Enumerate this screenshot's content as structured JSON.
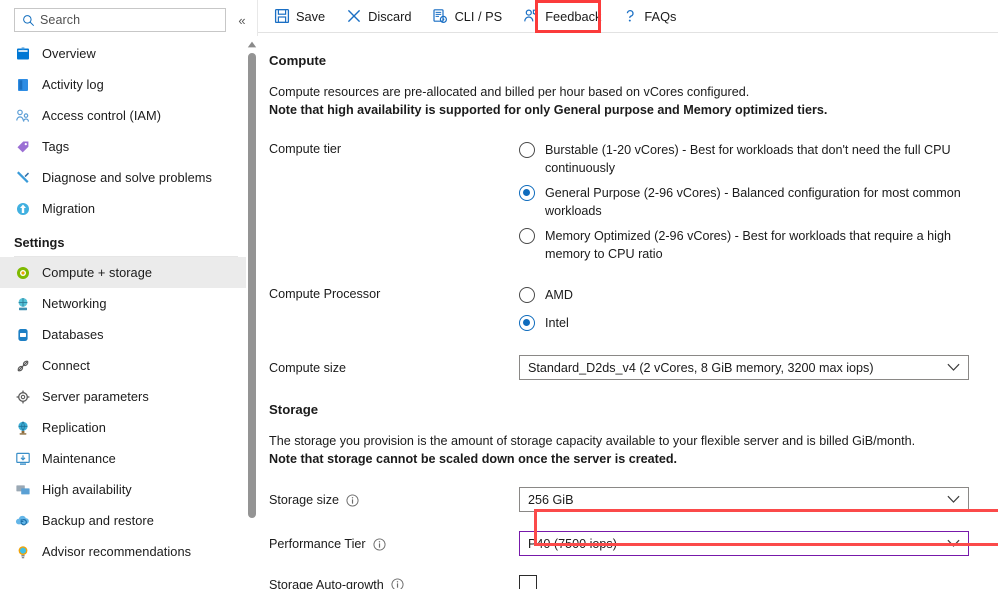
{
  "sidebar": {
    "search": {
      "placeholder": "Search",
      "icon": "search-icon"
    },
    "collapse_label": "«",
    "items": [
      {
        "label": "Overview",
        "icon": "overview-icon",
        "selected": false
      },
      {
        "label": "Activity log",
        "icon": "activity-log-icon",
        "selected": false
      },
      {
        "label": "Access control (IAM)",
        "icon": "access-control-icon",
        "selected": false
      },
      {
        "label": "Tags",
        "icon": "tags-icon",
        "selected": false
      },
      {
        "label": "Diagnose and solve problems",
        "icon": "diagnose-icon",
        "selected": false
      },
      {
        "label": "Migration",
        "icon": "migration-icon",
        "selected": false
      }
    ],
    "group_label": "Settings",
    "settings_items": [
      {
        "label": "Compute + storage",
        "icon": "compute-storage-icon",
        "selected": true
      },
      {
        "label": "Networking",
        "icon": "networking-icon",
        "selected": false
      },
      {
        "label": "Databases",
        "icon": "databases-icon",
        "selected": false
      },
      {
        "label": "Connect",
        "icon": "connect-icon",
        "selected": false
      },
      {
        "label": "Server parameters",
        "icon": "server-parameters-icon",
        "selected": false
      },
      {
        "label": "Replication",
        "icon": "replication-icon",
        "selected": false
      },
      {
        "label": "Maintenance",
        "icon": "maintenance-icon",
        "selected": false
      },
      {
        "label": "High availability",
        "icon": "high-availability-icon",
        "selected": false
      },
      {
        "label": "Backup and restore",
        "icon": "backup-restore-icon",
        "selected": false
      },
      {
        "label": "Advisor recommendations",
        "icon": "advisor-icon",
        "selected": false
      }
    ]
  },
  "toolbar": {
    "save_label": "Save",
    "discard_label": "Discard",
    "cli_ps_label": "CLI / PS",
    "feedback_label": "Feedback",
    "faqs_label": "FAQs"
  },
  "compute": {
    "title": "Compute",
    "desc_line1": "Compute resources are pre-allocated and billed per hour based on vCores configured.",
    "desc_line2": "Note that high availability is supported for only General purpose and Memory optimized tiers.",
    "tier_label": "Compute tier",
    "tier_options": [
      {
        "text": "Burstable (1-20 vCores) - Best for workloads that don't need the full CPU continuously",
        "checked": false
      },
      {
        "text": "General Purpose (2-96 vCores) - Balanced configuration for most common workloads",
        "checked": true
      },
      {
        "text": "Memory Optimized (2-96 vCores) - Best for workloads that require a high memory to CPU ratio",
        "checked": false
      }
    ],
    "processor_label": "Compute Processor",
    "processor_options": [
      {
        "text": "AMD",
        "checked": false
      },
      {
        "text": "Intel",
        "checked": true
      }
    ],
    "size_label": "Compute size",
    "size_value": "Standard_D2ds_v4 (2 vCores, 8 GiB memory, 3200 max iops)"
  },
  "storage": {
    "title": "Storage",
    "desc_line1": "The storage you provision is the amount of storage capacity available to your flexible server and is billed GiB/month.",
    "desc_line2": "Note that storage cannot be scaled down once the server is created.",
    "size_label": "Storage size",
    "size_value": "256 GiB",
    "perf_tier_label": "Performance Tier",
    "perf_tier_value": "P40 (7500 iops)",
    "auto_growth_label": "Storage Auto-growth",
    "auto_growth_checked": false
  },
  "colors": {
    "accent": "#0f6cbd",
    "highlight_red": "#fb4a4a",
    "focus_purple": "#7719aa",
    "selected_row": "#ebebeb"
  }
}
